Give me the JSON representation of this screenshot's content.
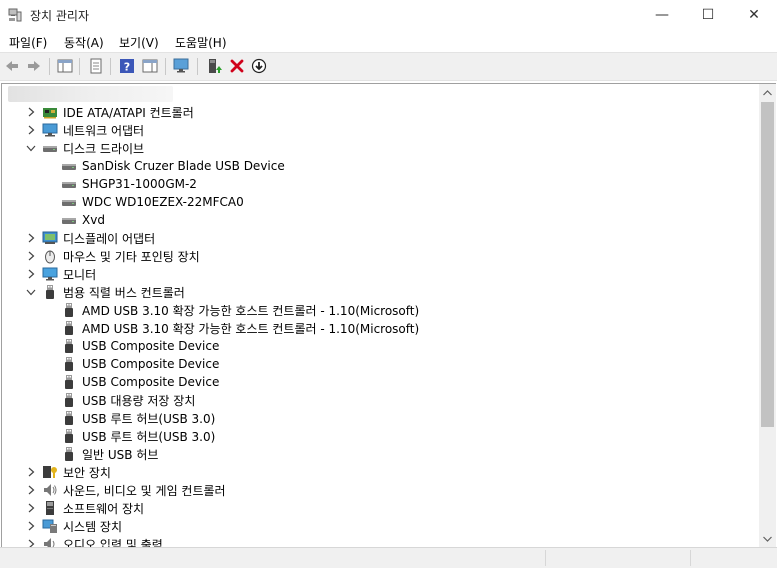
{
  "window": {
    "title": "장치 관리자",
    "minimize_glyph": "—",
    "maximize_glyph": "☐",
    "close_glyph": "✕"
  },
  "menu": [
    {
      "label": "파일(F)"
    },
    {
      "label": "동작(A)"
    },
    {
      "label": "보기(V)"
    },
    {
      "label": "도움말(H)"
    }
  ],
  "toolbar": {
    "buttons": [
      {
        "icon": "back-arrow-icon"
      },
      {
        "icon": "forward-arrow-icon"
      },
      {
        "icon": "show-hide-console-tree-icon"
      },
      {
        "icon": "properties-icon"
      },
      {
        "icon": "help-icon"
      },
      {
        "icon": "action-pane-icon"
      },
      {
        "icon": "scan-hardware-changes-icon"
      },
      {
        "icon": "update-driver-icon"
      },
      {
        "icon": "uninstall-device-icon"
      },
      {
        "icon": "disable-device-icon"
      }
    ],
    "uninstall_color": "#d0021b"
  },
  "tree": {
    "nodes": [
      {
        "label": "IDE ATA/ATAPI 컨트롤러",
        "level": 0,
        "expanded": false,
        "icon": "ide-controller-icon"
      },
      {
        "label": "네트워크 어댑터",
        "level": 0,
        "expanded": false,
        "icon": "network-adapter-icon"
      },
      {
        "label": "디스크 드라이브",
        "level": 0,
        "expanded": true,
        "icon": "disk-drive-icon"
      },
      {
        "label": "SanDisk Cruzer Blade USB Device",
        "level": 1,
        "icon": "disk-drive-icon"
      },
      {
        "label": "SHGP31-1000GM-2",
        "level": 1,
        "icon": "disk-drive-icon"
      },
      {
        "label": "WDC WD10EZEX-22MFCA0",
        "level": 1,
        "icon": "disk-drive-icon"
      },
      {
        "label": "Xvd",
        "level": 1,
        "icon": "disk-drive-icon"
      },
      {
        "label": "디스플레이 어댑터",
        "level": 0,
        "expanded": false,
        "icon": "display-adapter-icon"
      },
      {
        "label": "마우스 및 기타 포인팅 장치",
        "level": 0,
        "expanded": false,
        "icon": "mouse-icon"
      },
      {
        "label": "모니터",
        "level": 0,
        "expanded": false,
        "icon": "monitor-icon"
      },
      {
        "label": "범용 직렬 버스 컨트롤러",
        "level": 0,
        "expanded": true,
        "icon": "usb-icon"
      },
      {
        "label": "AMD USB 3.10 확장 가능한 호스트 컨트롤러 - 1.10(Microsoft)",
        "level": 1,
        "icon": "usb-icon"
      },
      {
        "label": "AMD USB 3.10 확장 가능한 호스트 컨트롤러 - 1.10(Microsoft)",
        "level": 1,
        "icon": "usb-icon"
      },
      {
        "label": "USB Composite Device",
        "level": 1,
        "icon": "usb-icon"
      },
      {
        "label": "USB Composite Device",
        "level": 1,
        "icon": "usb-icon"
      },
      {
        "label": "USB Composite Device",
        "level": 1,
        "icon": "usb-icon"
      },
      {
        "label": "USB 대용량 저장 장치",
        "level": 1,
        "icon": "usb-icon"
      },
      {
        "label": "USB 루트 허브(USB 3.0)",
        "level": 1,
        "icon": "usb-icon"
      },
      {
        "label": "USB 루트 허브(USB 3.0)",
        "level": 1,
        "icon": "usb-icon"
      },
      {
        "label": "일반 USB 허브",
        "level": 1,
        "icon": "usb-icon"
      },
      {
        "label": "보안 장치",
        "level": 0,
        "expanded": false,
        "icon": "security-device-icon"
      },
      {
        "label": "사운드, 비디오 및 게임 컨트롤러",
        "level": 0,
        "expanded": false,
        "icon": "sound-icon"
      },
      {
        "label": "소프트웨어 장치",
        "level": 0,
        "expanded": false,
        "icon": "software-device-icon"
      },
      {
        "label": "시스템 장치",
        "level": 0,
        "expanded": false,
        "icon": "system-device-icon"
      },
      {
        "label": "오디오 입력 및 출력",
        "level": 0,
        "expanded": false,
        "icon": "audio-io-icon"
      }
    ]
  }
}
